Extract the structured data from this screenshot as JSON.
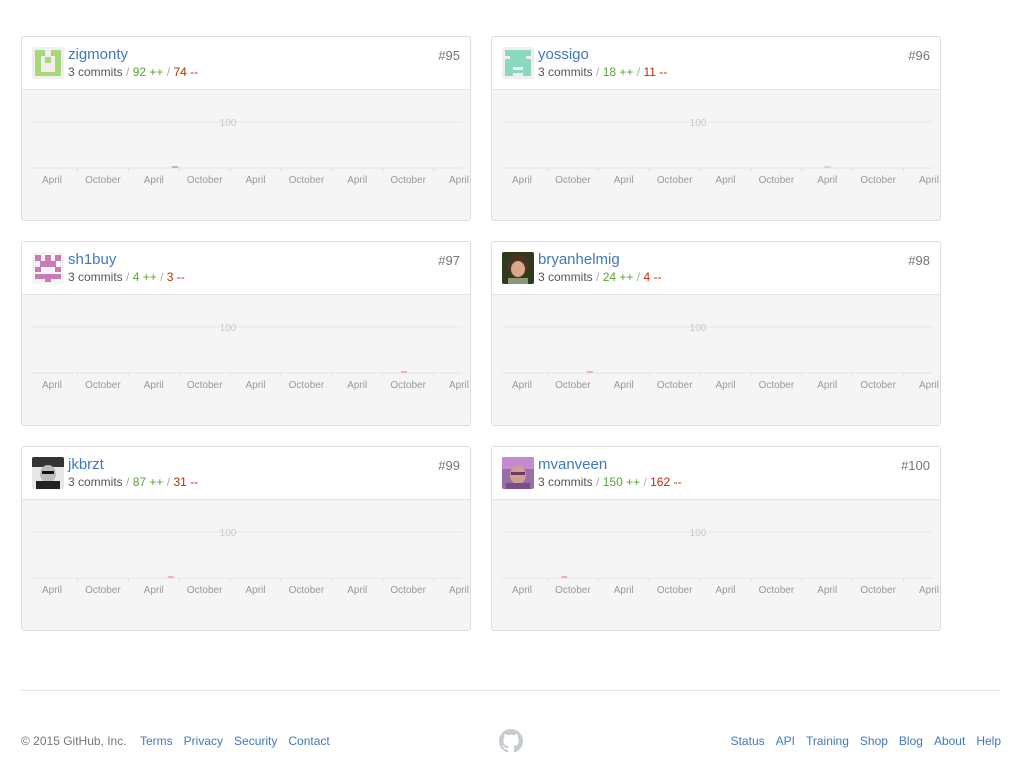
{
  "contributors": [
    {
      "username": "zigmonty",
      "commits": "3 commits",
      "additions": "92 ++",
      "deletions": "74 --",
      "rank": "#95",
      "avatar": "identicon-green-avatar",
      "spike_month_index": 29,
      "spike_color": "#aaaaaa"
    },
    {
      "username": "yossigo",
      "commits": "3 commits",
      "additions": "18 ++",
      "deletions": "11 --",
      "rank": "#96",
      "avatar": "identicon-teal-avatar",
      "spike_month_index": 72,
      "spike_color": "#f1c0b0"
    },
    {
      "username": "sh1buy",
      "commits": "3 commits",
      "additions": "4 ++",
      "deletions": "3 --",
      "rank": "#97",
      "avatar": "identicon-pink-avatar",
      "spike_month_index": 83,
      "spike_color": "#f0a090"
    },
    {
      "username": "bryanhelmig",
      "commits": "3 commits",
      "additions": "24 ++",
      "deletions": "4 --",
      "rank": "#98",
      "avatar": "photo-avatar",
      "spike_month_index": 16,
      "spike_color": "#f0a090"
    },
    {
      "username": "jkbrzt",
      "commits": "3 commits",
      "additions": "87 ++",
      "deletions": "31 --",
      "rank": "#99",
      "avatar": "photo-avatar",
      "spike_month_index": 28,
      "spike_color": "#f0a090"
    },
    {
      "username": "mvanveen",
      "commits": "3 commits",
      "additions": "150 ++",
      "deletions": "162 --",
      "rank": "#100",
      "avatar": "photo-avatar",
      "spike_month_index": 10,
      "spike_color": "#f0a090"
    }
  ],
  "chart": {
    "y_tick": "100",
    "x_ticks": [
      "April",
      "October",
      "April",
      "October",
      "April",
      "October",
      "April",
      "October",
      "April"
    ],
    "months_total": 96
  },
  "footer": {
    "copyright": "© 2015 GitHub, Inc.",
    "left_links": [
      "Terms",
      "Privacy",
      "Security",
      "Contact"
    ],
    "right_links": [
      "Status",
      "API",
      "Training",
      "Shop",
      "Blog",
      "About",
      "Help"
    ],
    "logo": "github-mark-icon"
  }
}
